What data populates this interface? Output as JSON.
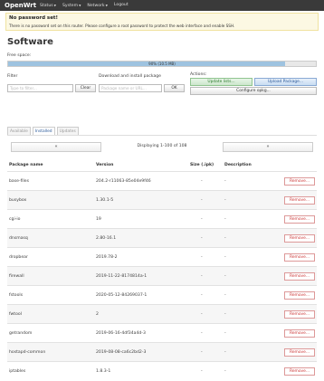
{
  "header": {
    "brand": "OpenWrt",
    "menu": [
      {
        "label": "Status"
      },
      {
        "label": "System"
      },
      {
        "label": "Network"
      },
      {
        "label": "Logout"
      }
    ]
  },
  "alert": {
    "title": "No password set!",
    "message": "There is no password set on this router. Please configure a root password to protect the web interface and enable SSH."
  },
  "page": {
    "title": "Software"
  },
  "free_space": {
    "label": "Free space:",
    "text": "90% (10.5 MB)",
    "fraction": 0.9
  },
  "filter": {
    "label": "Filter",
    "placeholder": "Type to filter...",
    "clear_label": "Clear"
  },
  "install": {
    "label": "Download and install package",
    "placeholder": "Package name or URL...",
    "ok_label": "OK"
  },
  "actions": {
    "label": "Actions:",
    "update_label": "Update lists...",
    "upload_label": "Upload Package...",
    "configure_label": "Configure opkg..."
  },
  "tabs": [
    {
      "label": "Available",
      "active": false
    },
    {
      "label": "Installed",
      "active": true
    },
    {
      "label": "Updates",
      "active": false
    }
  ],
  "pager": {
    "prev": "«",
    "next": "»",
    "text": "Displaying 1-100 of 108"
  },
  "table": {
    "headers": [
      "Package name",
      "Version",
      "Size (.ipk)",
      "Description"
    ],
    "remove_label": "Remove...",
    "rows": [
      {
        "name": "base-files",
        "version": "204.2-r11063-85e04e9f46",
        "size": "-",
        "desc": "-"
      },
      {
        "name": "busybox",
        "version": "1.30.1-5",
        "size": "-",
        "desc": "-"
      },
      {
        "name": "cgi-io",
        "version": "19",
        "size": "-",
        "desc": "-"
      },
      {
        "name": "dnsmasq",
        "version": "2.80-16.1",
        "size": "-",
        "desc": "-"
      },
      {
        "name": "dropbear",
        "version": "2019.78-2",
        "size": "-",
        "desc": "-"
      },
      {
        "name": "firewall",
        "version": "2019-11-22-8174814a-1",
        "size": "-",
        "desc": "-"
      },
      {
        "name": "fstools",
        "version": "2020-05-12-84269037-1",
        "size": "-",
        "desc": "-"
      },
      {
        "name": "fwtool",
        "version": "2",
        "size": "-",
        "desc": "-"
      },
      {
        "name": "getrandom",
        "version": "2019-06-16-4df34a4d-3",
        "size": "-",
        "desc": "-"
      },
      {
        "name": "hostapd-common",
        "version": "2019-08-08-ca6c2bd2-3",
        "size": "-",
        "desc": "-"
      },
      {
        "name": "iptables",
        "version": "1.8.3-1",
        "size": "-",
        "desc": "-"
      }
    ]
  }
}
